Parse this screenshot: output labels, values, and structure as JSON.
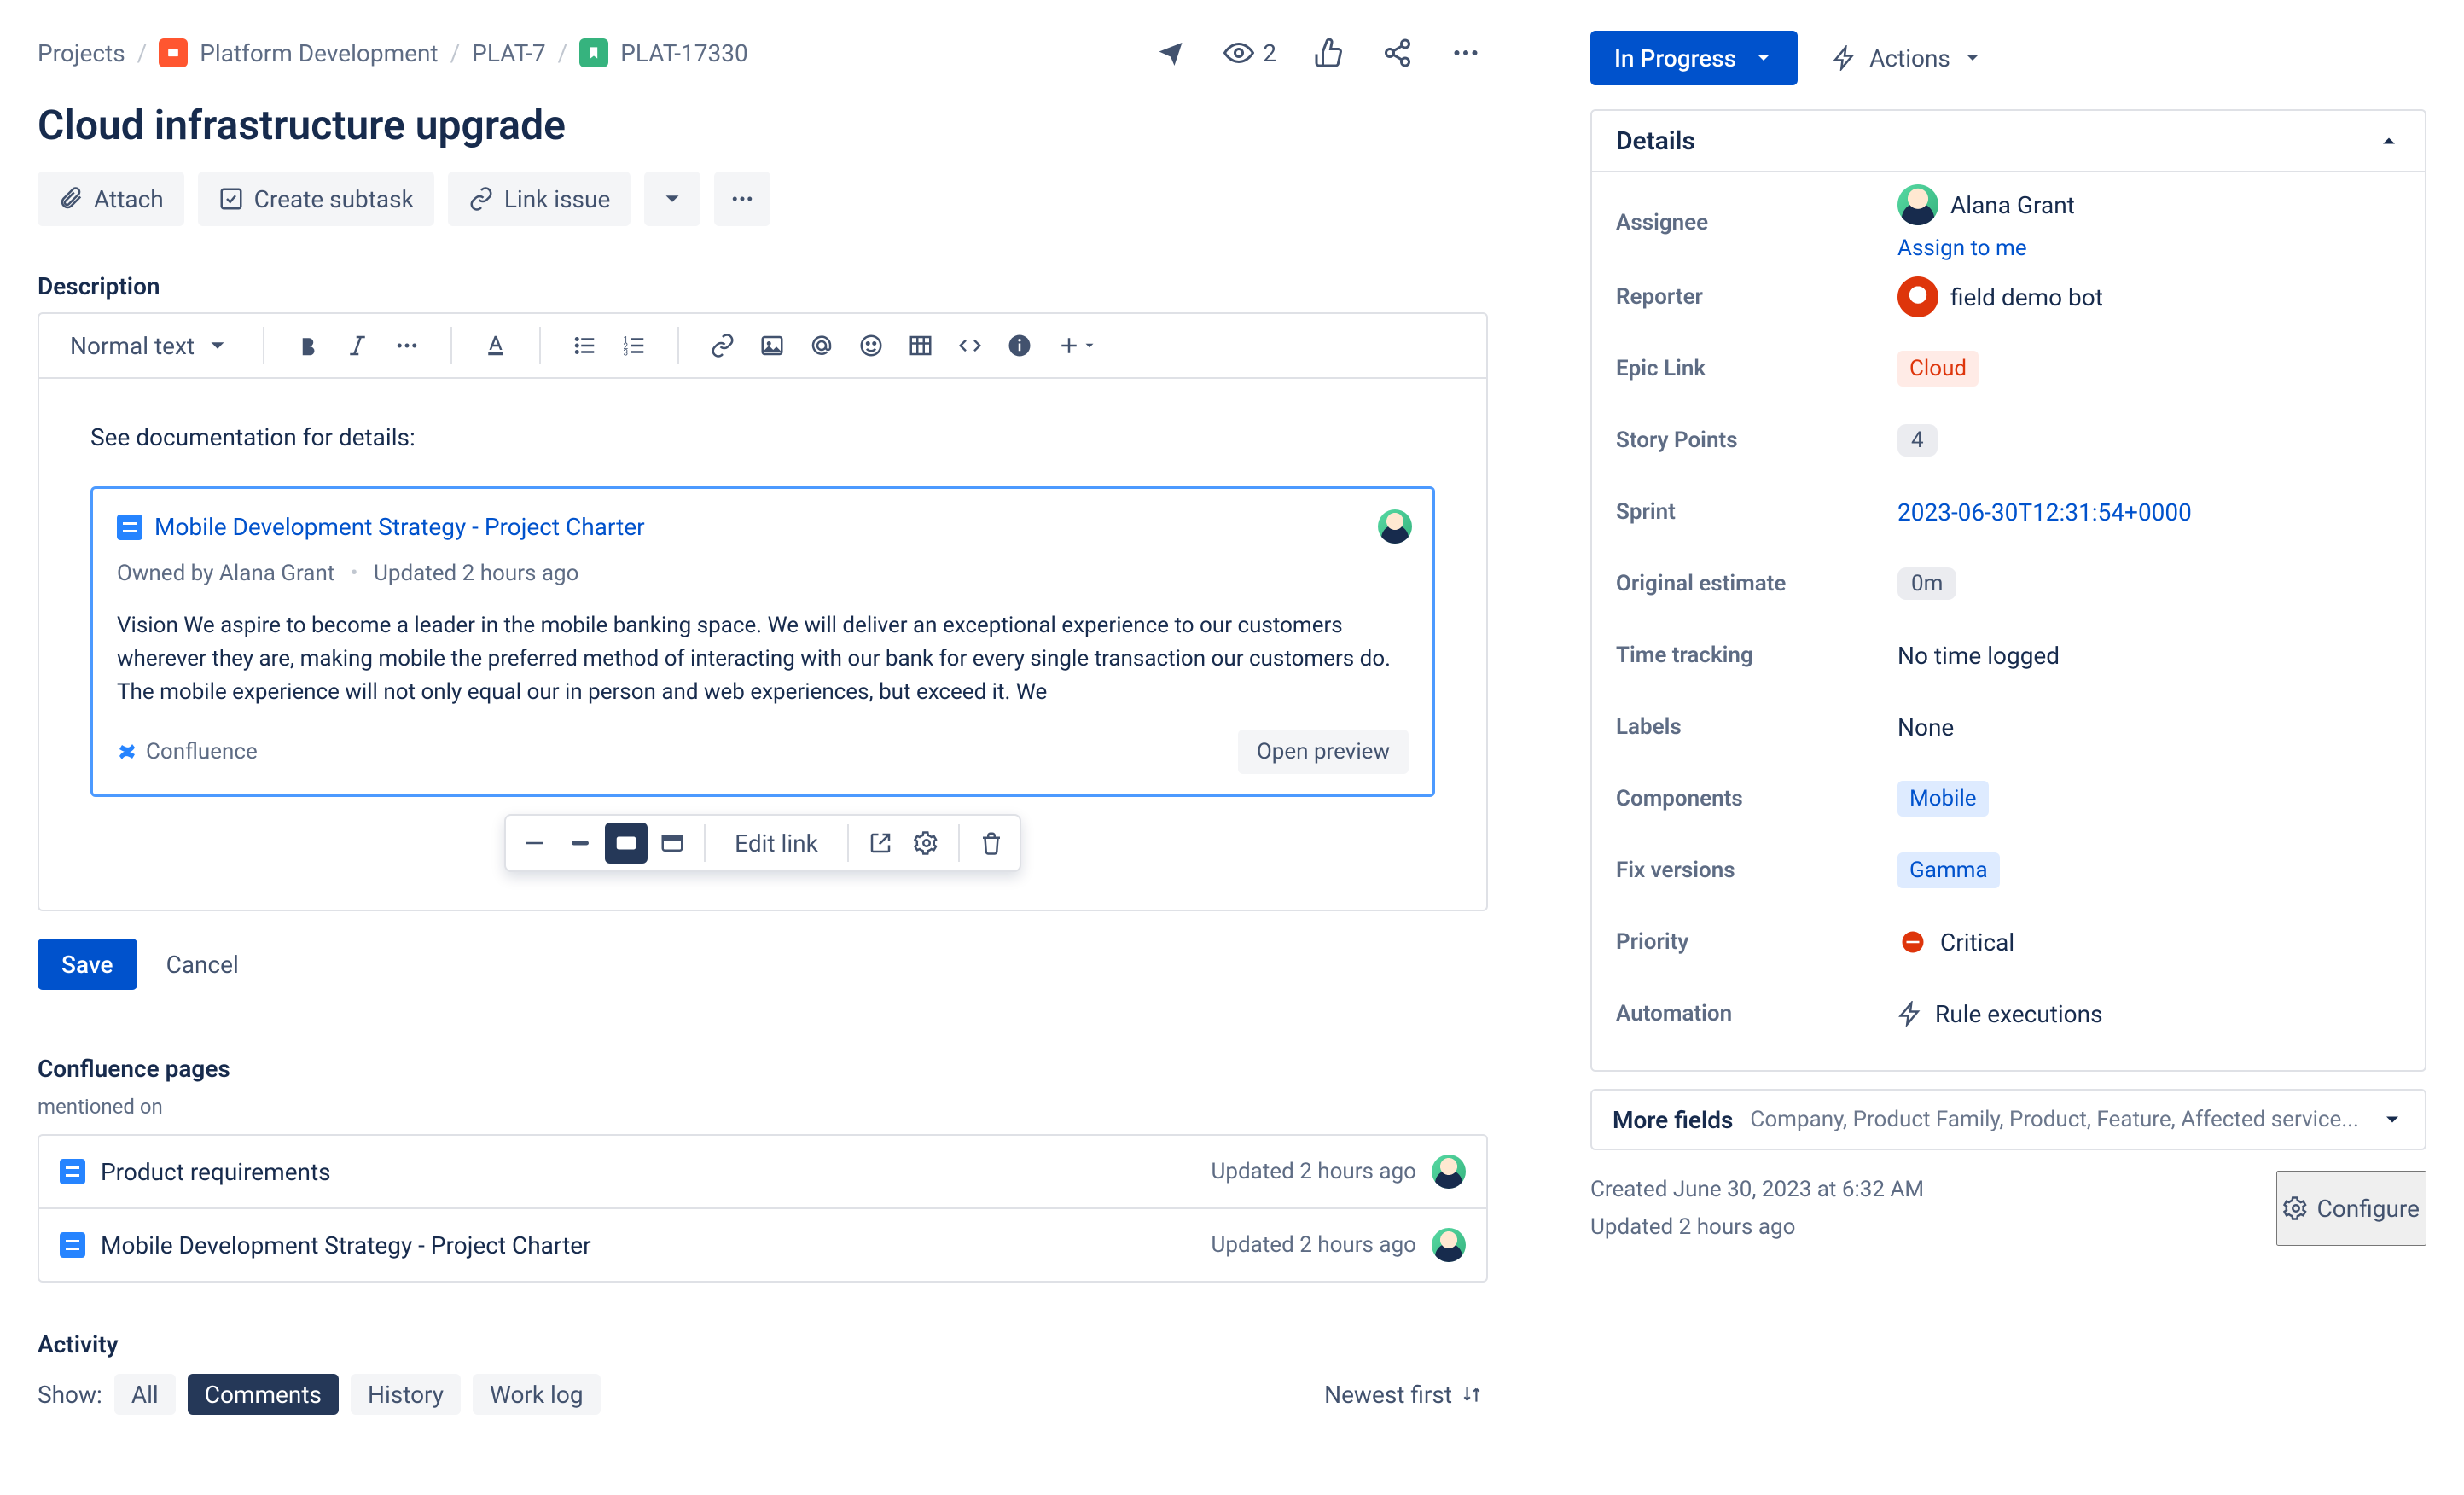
{
  "breadcrumb": {
    "projects": "Projects",
    "project": "Platform Development",
    "epic": "PLAT-7",
    "issue": "PLAT-17330"
  },
  "watchers_count": "2",
  "title": "Cloud infrastructure upgrade",
  "buttons": {
    "attach": "Attach",
    "create_subtask": "Create subtask",
    "link_issue": "Link issue",
    "save": "Save",
    "cancel": "Cancel",
    "open_preview": "Open preview",
    "edit_link": "Edit link"
  },
  "description": {
    "heading": "Description",
    "text_style": "Normal text",
    "intro": "See documentation for details:",
    "doc": {
      "title": "Mobile Development Strategy - Project Charter",
      "owner_prefix": "Owned by",
      "owner": "Alana Grant",
      "updated": "Updated 2 hours ago",
      "body": "Vision We aspire to become a leader in the mobile banking space. We will deliver an exceptional experience to our customers wherever they are, making mobile the preferred method of interacting with our bank for every single transaction our customers do. The mobile experience will not only equal our in person and web experiences, but exceed it. We",
      "source": "Confluence"
    }
  },
  "confluence": {
    "heading": "Confluence pages",
    "sub": "mentioned on",
    "items": [
      {
        "title": "Product requirements",
        "meta": "Updated 2 hours ago"
      },
      {
        "title": "Mobile Development Strategy - Project Charter",
        "meta": "Updated 2 hours ago"
      }
    ]
  },
  "activity": {
    "heading": "Activity",
    "show_label": "Show:",
    "tabs": {
      "all": "All",
      "comments": "Comments",
      "history": "History",
      "worklog": "Work log"
    },
    "sort": "Newest first"
  },
  "status": {
    "label": "In Progress"
  },
  "actions_label": "Actions",
  "details": {
    "heading": "Details",
    "fields": {
      "assignee_label": "Assignee",
      "assignee_value": "Alana Grant",
      "assign_to_me": "Assign to me",
      "reporter_label": "Reporter",
      "reporter_value": "field demo bot",
      "epic_label": "Epic Link",
      "epic_value": "Cloud",
      "sp_label": "Story Points",
      "sp_value": "4",
      "sprint_label": "Sprint",
      "sprint_value": "2023-06-30T12:31:54+0000",
      "oe_label": "Original estimate",
      "oe_value": "0m",
      "tt_label": "Time tracking",
      "tt_value": "No time logged",
      "labels_label": "Labels",
      "labels_value": "None",
      "components_label": "Components",
      "components_value": "Mobile",
      "fixv_label": "Fix versions",
      "fixv_value": "Gamma",
      "priority_label": "Priority",
      "priority_value": "Critical",
      "automation_label": "Automation",
      "automation_value": "Rule executions"
    }
  },
  "more_fields": {
    "label": "More fields",
    "list": "Company, Product Family, Product, Feature, Affected service..."
  },
  "side_meta": {
    "created": "Created June 30, 2023 at 6:32 AM",
    "updated": "Updated 2 hours ago",
    "configure": "Configure"
  }
}
